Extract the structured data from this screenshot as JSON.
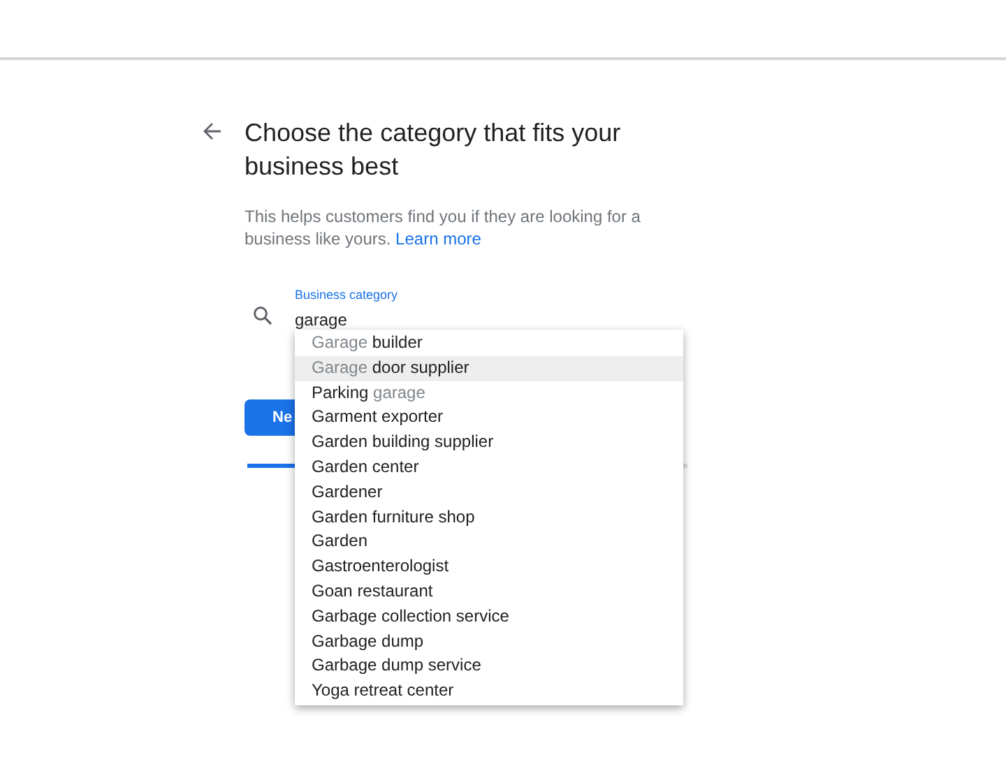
{
  "title": "Choose the category that fits your business best",
  "description": {
    "text": "This helps customers find you if they are looking for a business like yours.",
    "link": "Learn more"
  },
  "field": {
    "label": "Business category",
    "value": "garage"
  },
  "next_button": {
    "label": "Ne"
  },
  "progress": {
    "level": 0.11
  },
  "suggestions": [
    {
      "selected": false,
      "parts": [
        {
          "text": "Garage",
          "matched": true
        },
        {
          "text": " builder",
          "matched": false
        }
      ]
    },
    {
      "selected": true,
      "parts": [
        {
          "text": "Garage",
          "matched": true
        },
        {
          "text": " door supplier",
          "matched": false
        }
      ]
    },
    {
      "selected": false,
      "parts": [
        {
          "text": "Parking ",
          "matched": false
        },
        {
          "text": "garage",
          "matched": true
        }
      ]
    },
    {
      "selected": false,
      "parts": [
        {
          "text": "Garment exporter",
          "matched": false
        }
      ]
    },
    {
      "selected": false,
      "parts": [
        {
          "text": "Garden building supplier",
          "matched": false
        }
      ]
    },
    {
      "selected": false,
      "parts": [
        {
          "text": "Garden center",
          "matched": false
        }
      ]
    },
    {
      "selected": false,
      "parts": [
        {
          "text": "Gardener",
          "matched": false
        }
      ]
    },
    {
      "selected": false,
      "parts": [
        {
          "text": "Garden furniture shop",
          "matched": false
        }
      ]
    },
    {
      "selected": false,
      "parts": [
        {
          "text": "Garden",
          "matched": false
        }
      ]
    },
    {
      "selected": false,
      "parts": [
        {
          "text": "Gastroenterologist",
          "matched": false
        }
      ]
    },
    {
      "selected": false,
      "parts": [
        {
          "text": "Goan restaurant",
          "matched": false
        }
      ]
    },
    {
      "selected": false,
      "parts": [
        {
          "text": "Garbage collection service",
          "matched": false
        }
      ]
    },
    {
      "selected": false,
      "parts": [
        {
          "text": "Garbage dump",
          "matched": false
        }
      ]
    },
    {
      "selected": false,
      "parts": [
        {
          "text": "Garbage dump service",
          "matched": false
        }
      ]
    },
    {
      "selected": false,
      "parts": [
        {
          "text": "Yoga retreat center",
          "matched": false
        }
      ]
    }
  ]
}
